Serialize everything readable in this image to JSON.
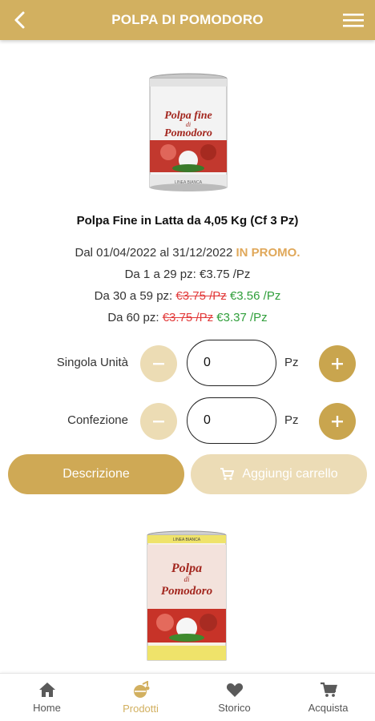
{
  "header": {
    "title": "POLPA DI POMODORO"
  },
  "product": {
    "name": "Polpa Fine in Latta da 4,05 Kg (Cf 3 Pz)",
    "promo_period": "Dal 01/04/2022 al 31/12/2022",
    "promo_tag": "IN PROMO.",
    "price_tiers": [
      {
        "range": "Da 1 a 29 pz:",
        "old_price": "",
        "price": "€3.75 /Pz"
      },
      {
        "range": "Da 30 a 59 pz:",
        "old_price": "€3.75 /Pz",
        "price": "€3.56 /Pz"
      },
      {
        "range": "Da 60 pz:",
        "old_price": "€3.75 /Pz",
        "price": "€3.37 /Pz"
      }
    ],
    "quantities": [
      {
        "label": "Singola Unità",
        "value": "0",
        "unit": "Pz"
      },
      {
        "label": "Confezione",
        "value": "0",
        "unit": "Pz"
      }
    ],
    "can_label_1": "Polpa fine",
    "can_label_2": "di",
    "can_label_3": "Pomodoro",
    "can_brand": "LINEA BIANCA"
  },
  "product2": {
    "can_label_1": "Polpa",
    "can_label_2": "di",
    "can_label_3": "Pomodoro",
    "can_brand": "LINEA BIANCA"
  },
  "buttons": {
    "description": "Descrizione",
    "add_to_cart": "Aggiungi carrello"
  },
  "bottom_nav": [
    {
      "label": "Home",
      "icon": "home-icon"
    },
    {
      "label": "Prodotti",
      "icon": "products-icon"
    },
    {
      "label": "Storico",
      "icon": "heart-icon"
    },
    {
      "label": "Acquista",
      "icon": "cart-icon"
    }
  ],
  "colors": {
    "brand": "#d2b060",
    "promo": "#e0a85a",
    "old_price": "#e23a3a",
    "new_price": "#2f9e3a"
  }
}
